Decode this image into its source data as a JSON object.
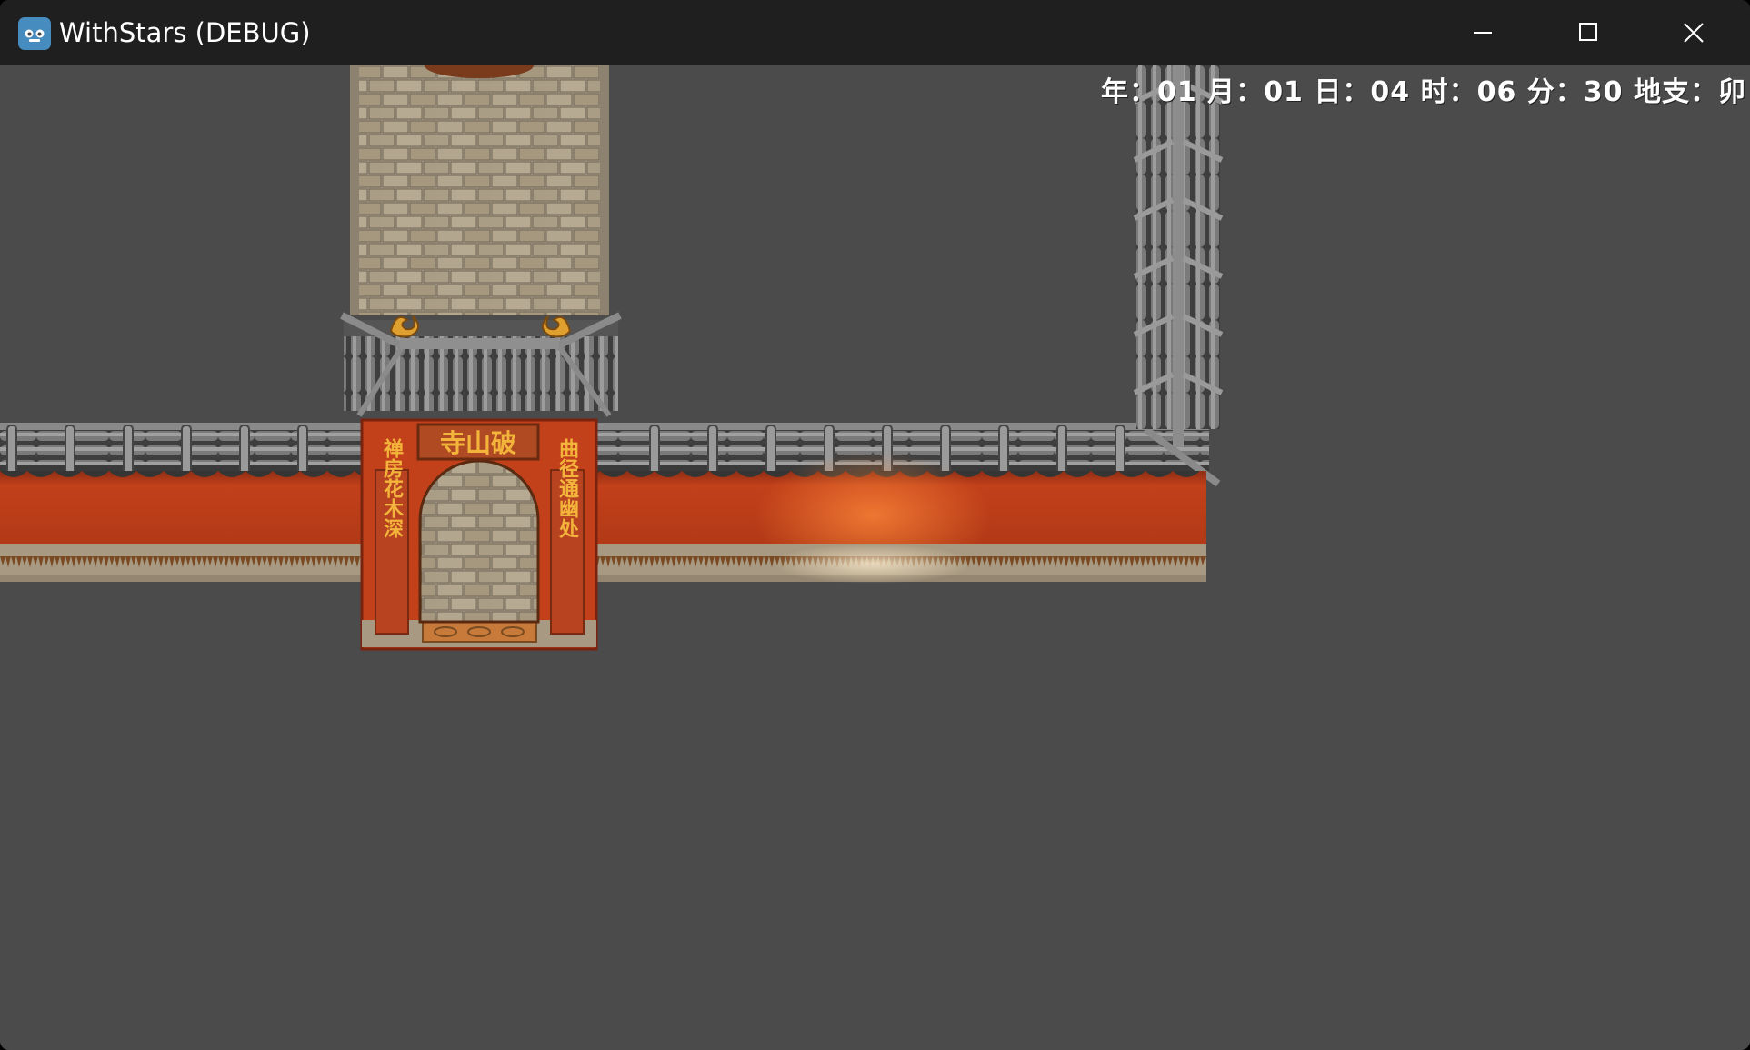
{
  "window": {
    "title": "WithStars (DEBUG)",
    "app_icon": "godot-robot-icon",
    "controls": [
      "minimize",
      "maximize",
      "close"
    ]
  },
  "hud": {
    "year_label": "年：",
    "month": "01",
    "month_label": " 月：",
    "day": "01",
    "day_label": " 日：",
    "hour": "04",
    "hour_label": " 时：",
    "minute": "06",
    "minute_label": " 分：",
    "second": "30",
    "branch_label": " 地支：",
    "branch": "卯"
  },
  "scene": {
    "gate_plaque": "寺山破",
    "left_couplet": "禅房花木深",
    "right_couplet": "曲径通幽处",
    "colors": {
      "background": "#4b4b4b",
      "wall_red": "#c2401a",
      "roof_tile": "#6e6e6e",
      "brick": "#a89c86",
      "gold": "#e0a030"
    }
  }
}
